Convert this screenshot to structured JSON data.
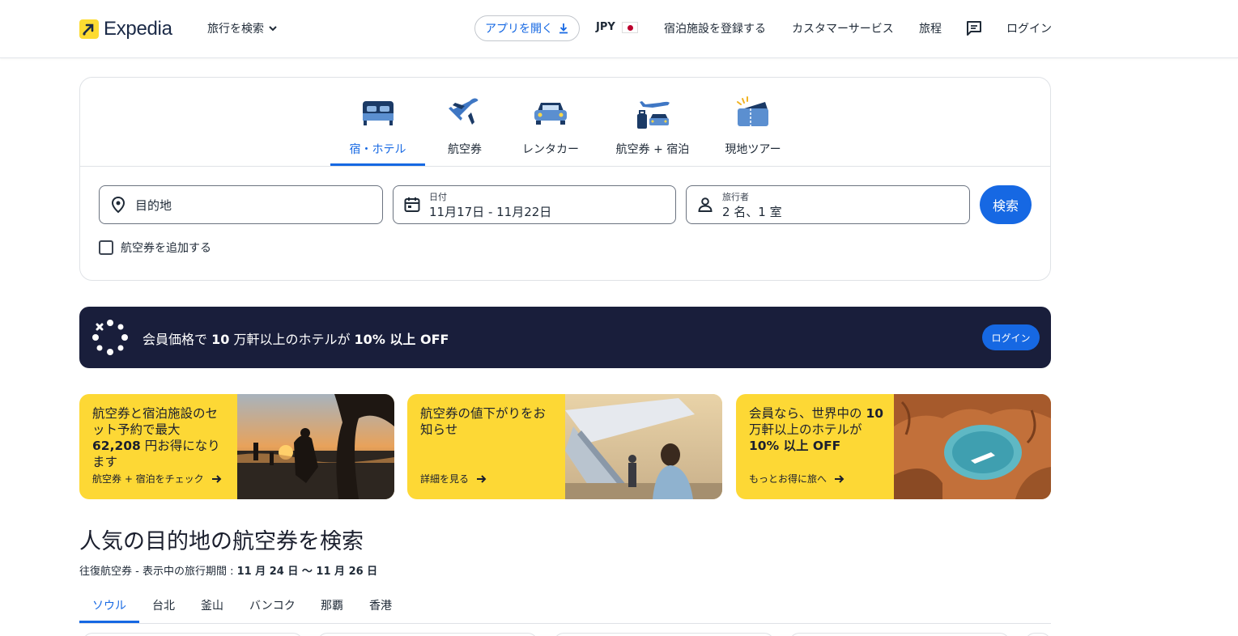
{
  "header": {
    "logo_text": "Expedia",
    "trip_menu": "旅行を検索",
    "app_button": "アプリを開く",
    "currency": "JPY",
    "list_property": "宿泊施設を登録する",
    "customer_service": "カスタマーサービス",
    "trips": "旅程",
    "login": "ログイン"
  },
  "search": {
    "tabs": [
      {
        "label": "宿・ホテル",
        "icon": "bed-icon"
      },
      {
        "label": "航空券",
        "icon": "plane-icon"
      },
      {
        "label": "レンタカー",
        "icon": "car-icon"
      },
      {
        "label": "航空券 + 宿泊",
        "icon": "plane-suitcase-icon"
      },
      {
        "label": "現地ツアー",
        "icon": "ticket-icon"
      }
    ],
    "destination_placeholder": "目的地",
    "dates_label": "日付",
    "dates_value": "11月17日 - 11月22日",
    "travelers_label": "旅行者",
    "travelers_value": "2 名、1 室",
    "search_button": "検索",
    "add_flight": "航空券を追加する"
  },
  "member": {
    "text_a": "会員価格で ",
    "text_b": "10",
    "text_c": " 万軒以上のホテルが ",
    "text_d": "10% 以上 OFF",
    "login": "ログイン"
  },
  "promos": [
    {
      "text_a": "航空券と宿泊施設のセット予約で最大 ",
      "text_b": "62,208",
      "text_c": " 円お得になります",
      "link": "航空券 + 宿泊をチェック"
    },
    {
      "text_a": "航空券の値下がりをお知らせ",
      "text_b": "",
      "text_c": "",
      "link": "詳細を見る"
    },
    {
      "text_a": "会員なら、世界中の ",
      "text_b": "10",
      "text_c": " 万軒以上のホテルが ",
      "text_d": "10% 以上 OFF",
      "link": "もっとお得に旅へ"
    }
  ],
  "popular": {
    "title": "人気の目的地の航空券を検索",
    "subtitle_a": "往復航空券 - 表示中の旅行期間 : ",
    "subtitle_b": "11 月 24 日 〜 11 月 26 日",
    "cities": [
      "ソウル",
      "台北",
      "釜山",
      "バンコク",
      "那覇",
      "香港"
    ]
  },
  "colors": {
    "accent": "#1668e3",
    "promo_yellow": "#fdd835",
    "banner_navy": "#191e3b"
  }
}
